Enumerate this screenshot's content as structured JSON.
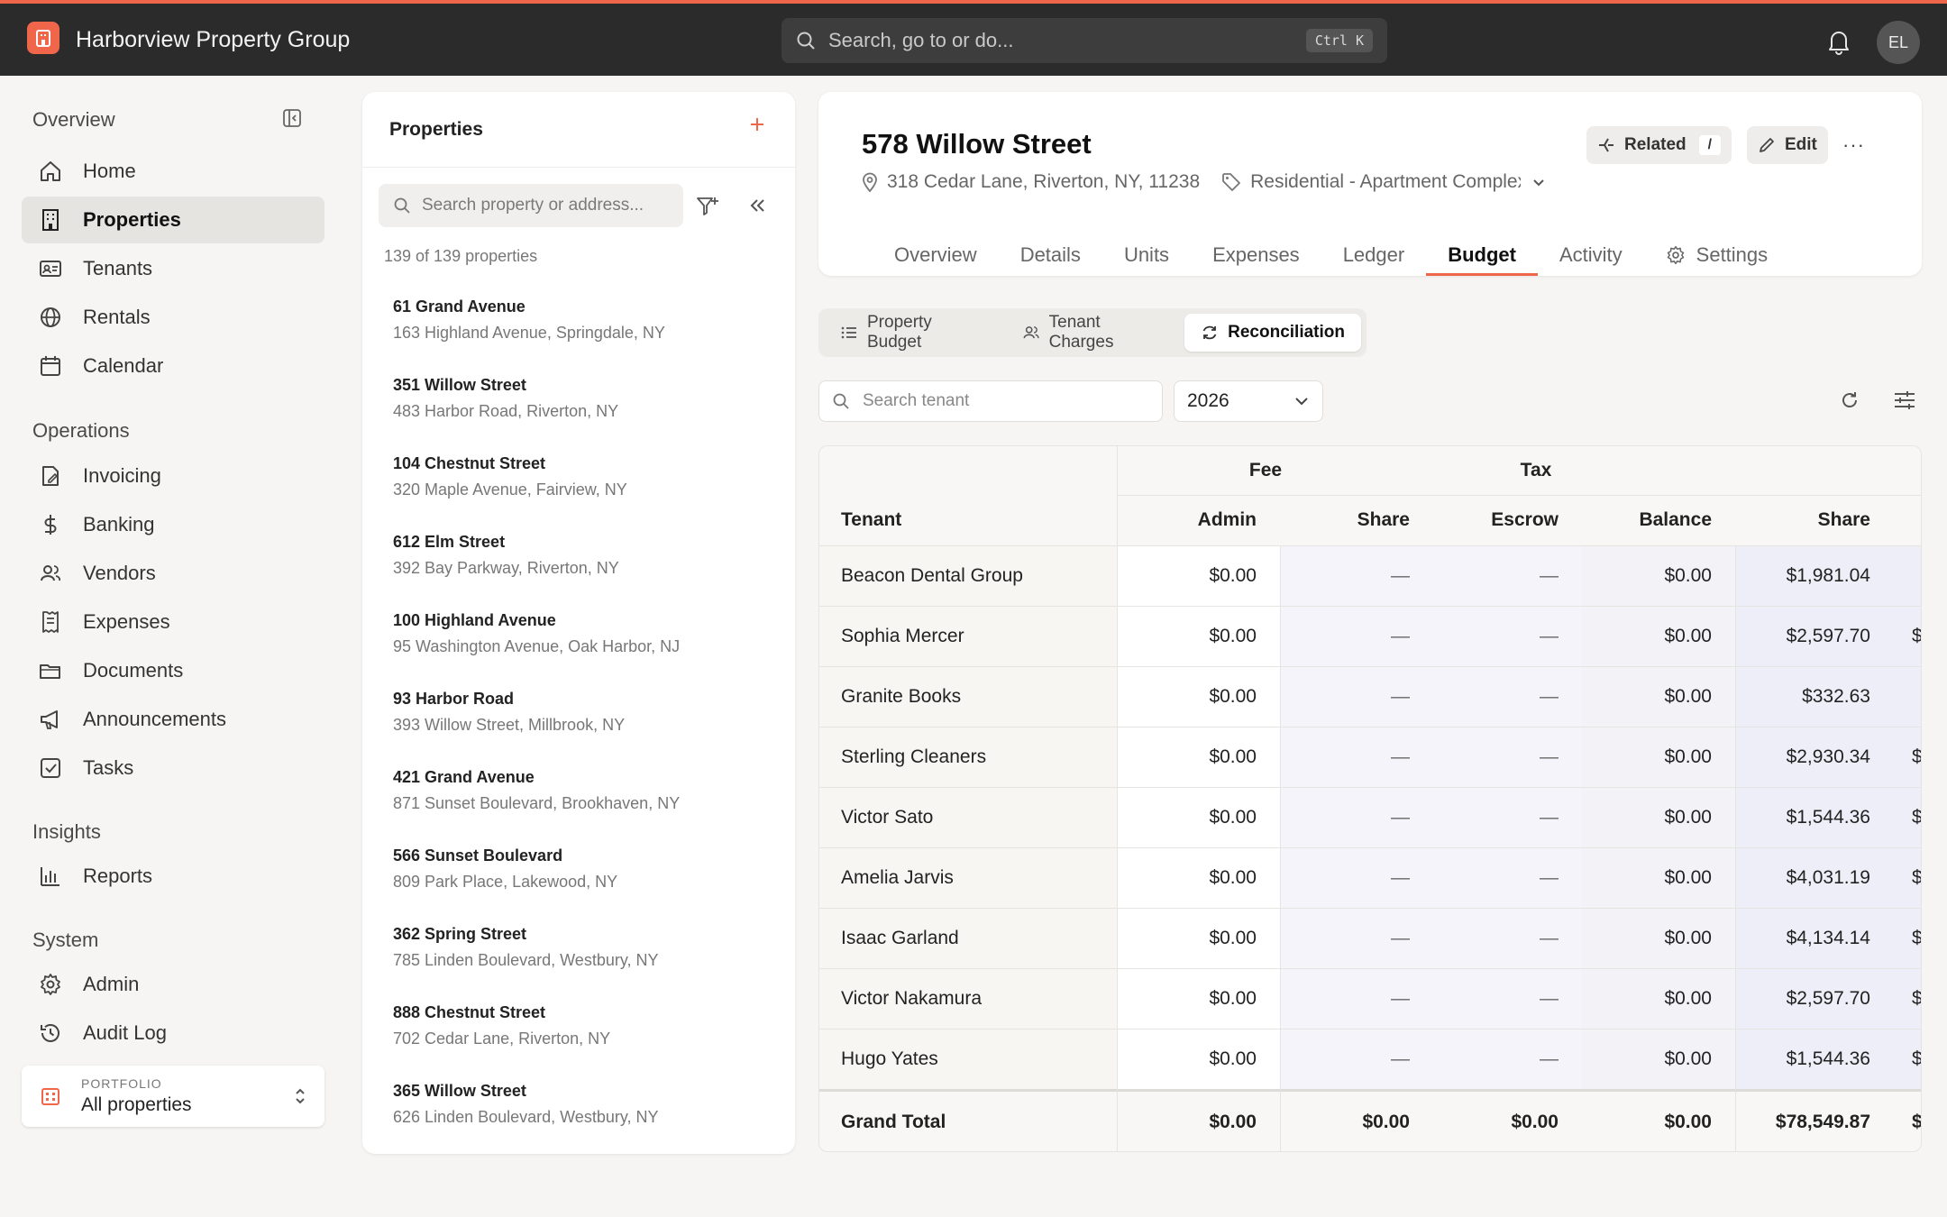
{
  "app": {
    "title": "Harborview Property Group"
  },
  "global_search": {
    "placeholder": "Search, go to or do...",
    "shortcut": "Ctrl K"
  },
  "user": {
    "initials": "EL"
  },
  "colors": {
    "accent": "#f0664a",
    "topbar": "#2b2b2b"
  },
  "sidebar": {
    "sections": [
      {
        "title": "Overview",
        "items": [
          {
            "label": "Home",
            "icon": "home-icon"
          },
          {
            "label": "Properties",
            "icon": "building-icon",
            "active": true
          },
          {
            "label": "Tenants",
            "icon": "id-card-icon"
          },
          {
            "label": "Rentals",
            "icon": "globe-icon"
          },
          {
            "label": "Calendar",
            "icon": "calendar-icon"
          }
        ]
      },
      {
        "title": "Operations",
        "items": [
          {
            "label": "Invoicing",
            "icon": "invoice-icon"
          },
          {
            "label": "Banking",
            "icon": "dollar-icon"
          },
          {
            "label": "Vendors",
            "icon": "users-icon"
          },
          {
            "label": "Expenses",
            "icon": "receipt-icon"
          },
          {
            "label": "Documents",
            "icon": "folder-icon"
          },
          {
            "label": "Announcements",
            "icon": "megaphone-icon"
          },
          {
            "label": "Tasks",
            "icon": "checkbox-icon"
          }
        ]
      },
      {
        "title": "Insights",
        "items": [
          {
            "label": "Reports",
            "icon": "bar-chart-icon"
          }
        ]
      },
      {
        "title": "System",
        "items": [
          {
            "label": "Admin",
            "icon": "gear-icon"
          },
          {
            "label": "Audit Log",
            "icon": "history-icon"
          }
        ]
      }
    ],
    "portfolio": {
      "caption": "PORTFOLIO",
      "value": "All properties"
    }
  },
  "properties_panel": {
    "title": "Properties",
    "search_placeholder": "Search property or address...",
    "count_text": "139 of 139 properties",
    "items": [
      {
        "name": "61 Grand Avenue",
        "address": "163 Highland Avenue, Springdale, NY"
      },
      {
        "name": "351 Willow Street",
        "address": "483 Harbor Road, Riverton, NY"
      },
      {
        "name": "104 Chestnut Street",
        "address": "320 Maple Avenue, Fairview, NY"
      },
      {
        "name": "612 Elm Street",
        "address": "392 Bay Parkway, Riverton, NY"
      },
      {
        "name": "100 Highland Avenue",
        "address": "95 Washington Avenue, Oak Harbor, NJ"
      },
      {
        "name": "93 Harbor Road",
        "address": "393 Willow Street, Millbrook, NY"
      },
      {
        "name": "421 Grand Avenue",
        "address": "871 Sunset Boulevard, Brookhaven, NY"
      },
      {
        "name": "566 Sunset Boulevard",
        "address": "809 Park Place, Lakewood, NY"
      },
      {
        "name": "362 Spring Street",
        "address": "785 Linden Boulevard, Westbury, NY"
      },
      {
        "name": "888 Chestnut Street",
        "address": "702 Cedar Lane, Riverton, NY"
      },
      {
        "name": "365 Willow Street",
        "address": "626 Linden Boulevard, Westbury, NY"
      }
    ]
  },
  "detail": {
    "title": "578 Willow Street",
    "address": "318 Cedar Lane, Riverton, NY, 11238",
    "category": "Residential - Apartment Complex",
    "related_label": "Related",
    "related_shortcut": "/",
    "edit_label": "Edit",
    "more_label": "···",
    "tabs": [
      "Overview",
      "Details",
      "Units",
      "Expenses",
      "Ledger",
      "Budget",
      "Activity",
      "Settings"
    ],
    "active_tab": "Budget"
  },
  "subtabs": [
    {
      "label": "Property Budget",
      "icon": "list-icon"
    },
    {
      "label": "Tenant Charges",
      "icon": "users-icon"
    },
    {
      "label": "Reconciliation",
      "icon": "refresh-icon",
      "active": true
    }
  ],
  "filters": {
    "tenant_placeholder": "Search tenant",
    "year": "2026"
  },
  "table": {
    "group_headers": {
      "fee": "Fee",
      "tax": "Tax"
    },
    "columns": [
      "Tenant",
      "Admin",
      "Share",
      "Escrow",
      "Balance",
      "Share"
    ],
    "rows": [
      {
        "tenant": "Beacon Dental Group",
        "admin": "$0.00",
        "fee_share": "—",
        "escrow": "—",
        "balance": "$0.00",
        "tax_share": "$1,981.04",
        "overflow": ""
      },
      {
        "tenant": "Sophia Mercer",
        "admin": "$0.00",
        "fee_share": "—",
        "escrow": "—",
        "balance": "$0.00",
        "tax_share": "$2,597.70",
        "overflow": "$"
      },
      {
        "tenant": "Granite Books",
        "admin": "$0.00",
        "fee_share": "—",
        "escrow": "—",
        "balance": "$0.00",
        "tax_share": "$332.63",
        "overflow": ""
      },
      {
        "tenant": "Sterling Cleaners",
        "admin": "$0.00",
        "fee_share": "—",
        "escrow": "—",
        "balance": "$0.00",
        "tax_share": "$2,930.34",
        "overflow": "$"
      },
      {
        "tenant": "Victor Sato",
        "admin": "$0.00",
        "fee_share": "—",
        "escrow": "—",
        "balance": "$0.00",
        "tax_share": "$1,544.36",
        "overflow": "$"
      },
      {
        "tenant": "Amelia Jarvis",
        "admin": "$0.00",
        "fee_share": "—",
        "escrow": "—",
        "balance": "$0.00",
        "tax_share": "$4,031.19",
        "overflow": "$"
      },
      {
        "tenant": "Isaac Garland",
        "admin": "$0.00",
        "fee_share": "—",
        "escrow": "—",
        "balance": "$0.00",
        "tax_share": "$4,134.14",
        "overflow": "$"
      },
      {
        "tenant": "Victor Nakamura",
        "admin": "$0.00",
        "fee_share": "—",
        "escrow": "—",
        "balance": "$0.00",
        "tax_share": "$2,597.70",
        "overflow": "$"
      },
      {
        "tenant": "Hugo Yates",
        "admin": "$0.00",
        "fee_share": "—",
        "escrow": "—",
        "balance": "$0.00",
        "tax_share": "$1,544.36",
        "overflow": "$"
      }
    ],
    "total": {
      "label": "Grand Total",
      "admin": "$0.00",
      "fee_share": "$0.00",
      "escrow": "$0.00",
      "balance": "$0.00",
      "tax_share": "$78,549.87",
      "overflow": "$"
    }
  }
}
